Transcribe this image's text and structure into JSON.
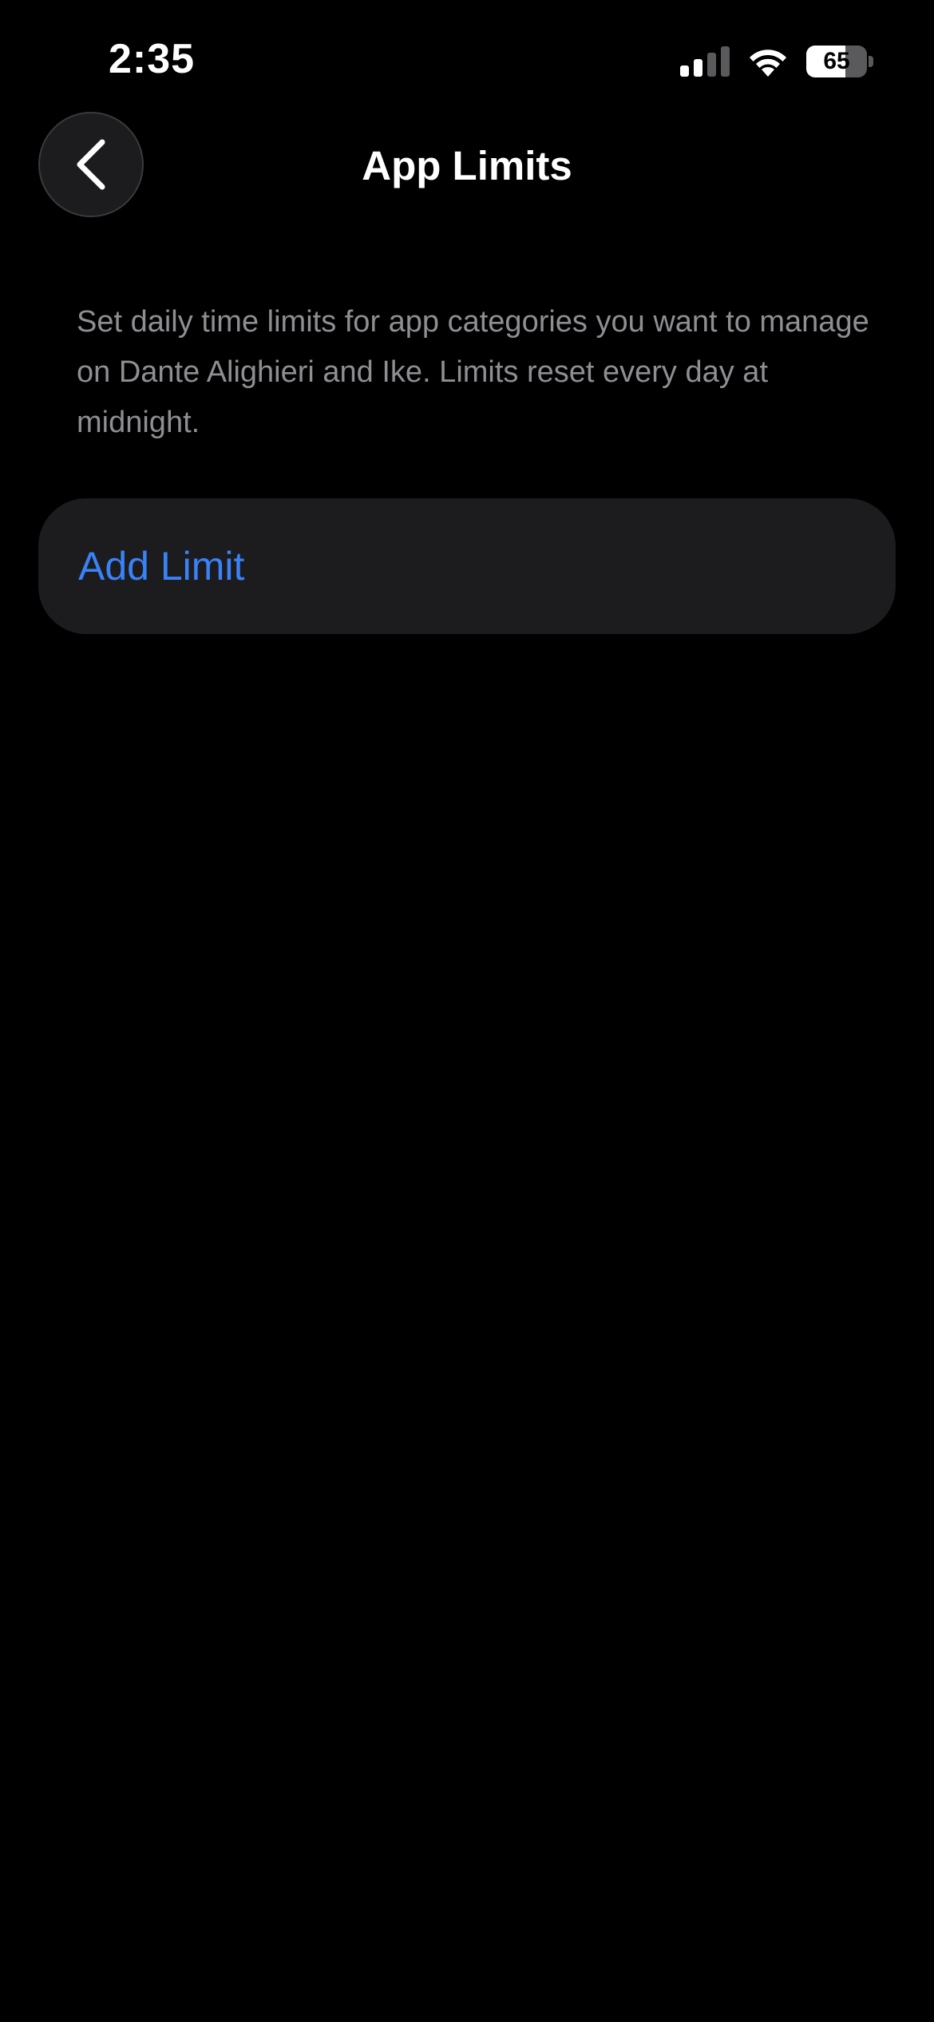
{
  "status_bar": {
    "time": "2:35",
    "signal_icon": "cellular-signal-icon",
    "signal_bars_active": 2,
    "signal_bars_total": 4,
    "wifi_icon": "wifi-icon",
    "battery_percent": "65",
    "battery_level": 0.65
  },
  "nav": {
    "back_icon": "chevron-left-icon",
    "title": "App Limits"
  },
  "description": "Set daily time limits for app categories you want to manage on Dante Alighieri and Ike. Limits reset every day at midnight.",
  "add_limit": {
    "label": "Add Limit"
  },
  "colors": {
    "background": "#000000",
    "card": "#1c1c1e",
    "secondary_text": "#8e8e93",
    "accent": "#3a82f7"
  }
}
